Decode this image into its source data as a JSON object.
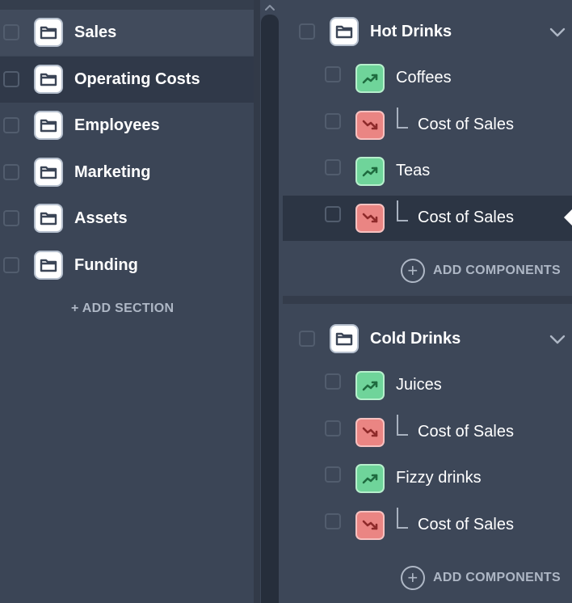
{
  "sections": [
    {
      "label": "Sales",
      "state": "hover"
    },
    {
      "label": "Operating Costs",
      "state": "active"
    },
    {
      "label": "Employees",
      "state": ""
    },
    {
      "label": "Marketing",
      "state": ""
    },
    {
      "label": "Assets",
      "state": ""
    },
    {
      "label": "Funding",
      "state": ""
    }
  ],
  "add_section_label": "+ ADD SECTION",
  "groups": [
    {
      "title": "Hot Drinks",
      "components": [
        {
          "label": "Coffees",
          "trend": "up",
          "child": false
        },
        {
          "label": "Cost of Sales",
          "trend": "down",
          "child": true
        },
        {
          "label": "Teas",
          "trend": "up",
          "child": false
        },
        {
          "label": "Cost of Sales",
          "trend": "down",
          "child": true,
          "selected": true
        }
      ],
      "add_label": "ADD COMPONENTS"
    },
    {
      "title": "Cold Drinks",
      "components": [
        {
          "label": "Juices",
          "trend": "up",
          "child": false
        },
        {
          "label": "Cost of Sales",
          "trend": "down",
          "child": true
        },
        {
          "label": "Fizzy drinks",
          "trend": "up",
          "child": false
        },
        {
          "label": "Cost of Sales",
          "trend": "down",
          "child": true
        }
      ],
      "add_label": "ADD COMPONENTS"
    }
  ],
  "icons": {
    "section": "folder-icon",
    "up": "trend-up-icon",
    "down": "trend-down-icon",
    "add": "plus-circle-icon",
    "collapse": "chevron-down-icon"
  },
  "colors": {
    "trend_up": "#6fd49a",
    "trend_down": "#ea8583",
    "selected_row": "#2c3544"
  }
}
